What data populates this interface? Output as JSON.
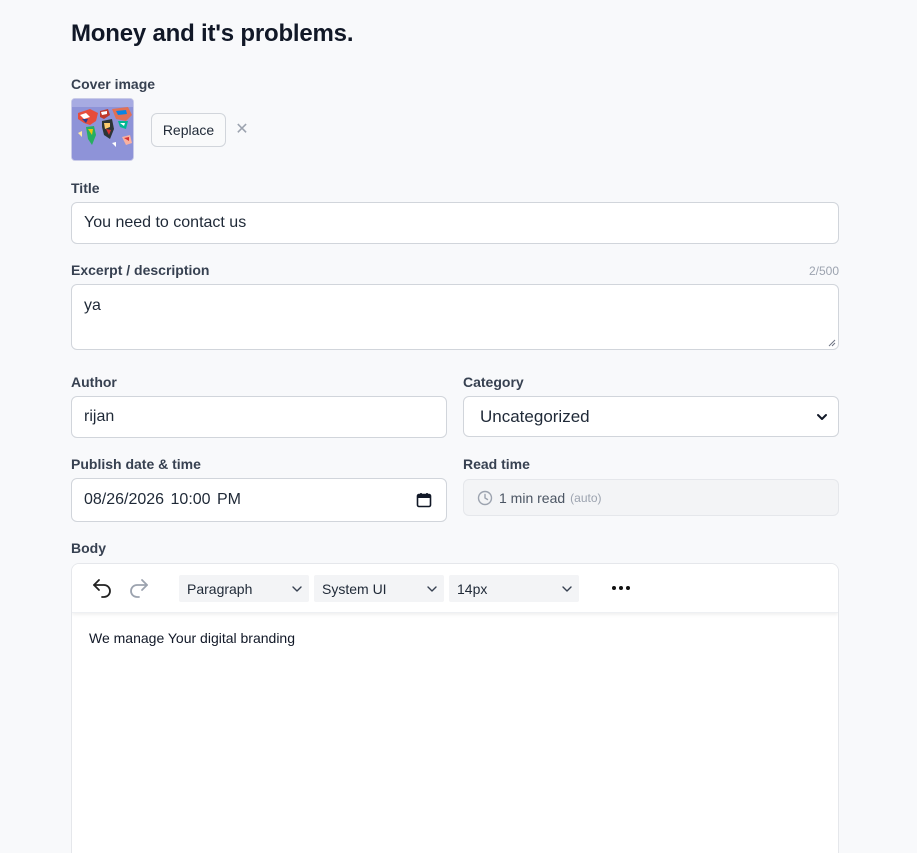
{
  "page": {
    "title": "Money and it's problems."
  },
  "cover": {
    "label": "Cover image",
    "replace_label": "Replace",
    "remove_glyph": "✕"
  },
  "title_field": {
    "label": "Title",
    "value": "You need to contact us"
  },
  "excerpt": {
    "label": "Excerpt / description",
    "counter": "2/500",
    "value": "ya"
  },
  "author": {
    "label": "Author",
    "value": "rijan"
  },
  "category": {
    "label": "Category",
    "value": "Uncategorized"
  },
  "publish": {
    "label": "Publish date & time",
    "value": "08/26/2026 10:00 PM"
  },
  "read_time": {
    "label": "Read time",
    "value": "1 min read",
    "auto": "(auto)"
  },
  "body": {
    "label": "Body",
    "toolbar": {
      "block_type": "Paragraph",
      "font_family": "System UI",
      "font_size": "14px"
    },
    "content": "We manage Your digital branding"
  },
  "icons": {
    "undo": "undo-icon",
    "redo": "redo-icon",
    "more": "more-horizontal-icon",
    "clock": "clock-icon",
    "calendar": "calendar-icon",
    "chevron": "chevron-down-icon"
  },
  "colors": {
    "background": "#f8f9fb",
    "border": "#d1d5db",
    "text": "#111827",
    "muted": "#9ca3af"
  }
}
